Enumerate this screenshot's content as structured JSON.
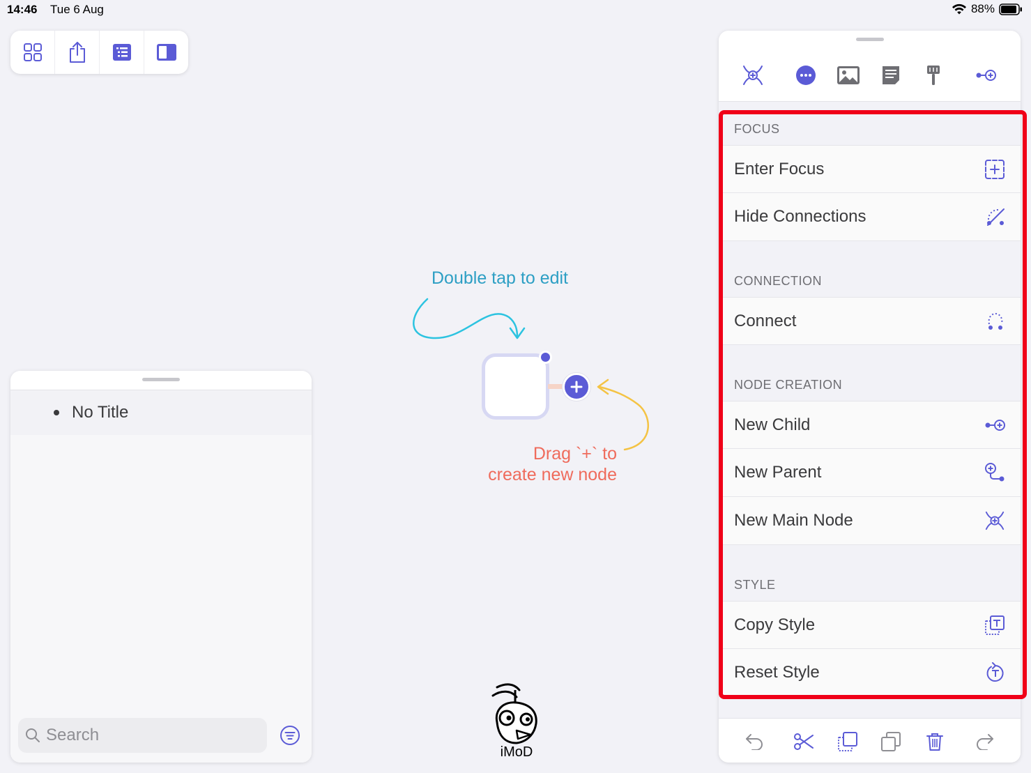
{
  "status_bar": {
    "time": "14:46",
    "date": "Tue 6 Aug",
    "battery": "88%"
  },
  "toolbar": {
    "buttons": [
      {
        "name": "grid-view",
        "icon": "grid-icon"
      },
      {
        "name": "share",
        "icon": "share-icon"
      },
      {
        "name": "outline-list",
        "icon": "list-icon"
      },
      {
        "name": "sidebar",
        "icon": "sidebar-icon"
      }
    ]
  },
  "outline": {
    "items": [
      "No Title"
    ],
    "search_placeholder": "Search"
  },
  "canvas": {
    "hint_edit": "Double tap to edit",
    "hint_drag_line1": "Drag `+` to",
    "hint_drag_line2": "create new node"
  },
  "watermark": {
    "text": "iMoD"
  },
  "inspector": {
    "tabs": [
      "main-node-icon",
      "more-icon",
      "image-icon",
      "note-icon",
      "style-brush-icon",
      "new-child-icon"
    ],
    "sections": [
      {
        "label": "FOCUS",
        "rows": [
          "Enter Focus",
          "Hide Connections"
        ]
      },
      {
        "label": "CONNECTION",
        "rows": [
          "Connect"
        ]
      },
      {
        "label": "NODE CREATION",
        "rows": [
          "New Child",
          "New Parent",
          "New Main Node"
        ]
      },
      {
        "label": "STYLE",
        "rows": [
          "Copy Style",
          "Reset Style"
        ]
      }
    ],
    "footer": [
      "undo-icon",
      "cut-icon",
      "copy-icon",
      "paste-icon",
      "delete-icon",
      "redo-icon"
    ]
  },
  "colors": {
    "accent": "#5b5bd6",
    "hint_edit": "#2d9fc4",
    "hint_drag": "#ef6b5c",
    "highlight": "#f00018"
  }
}
